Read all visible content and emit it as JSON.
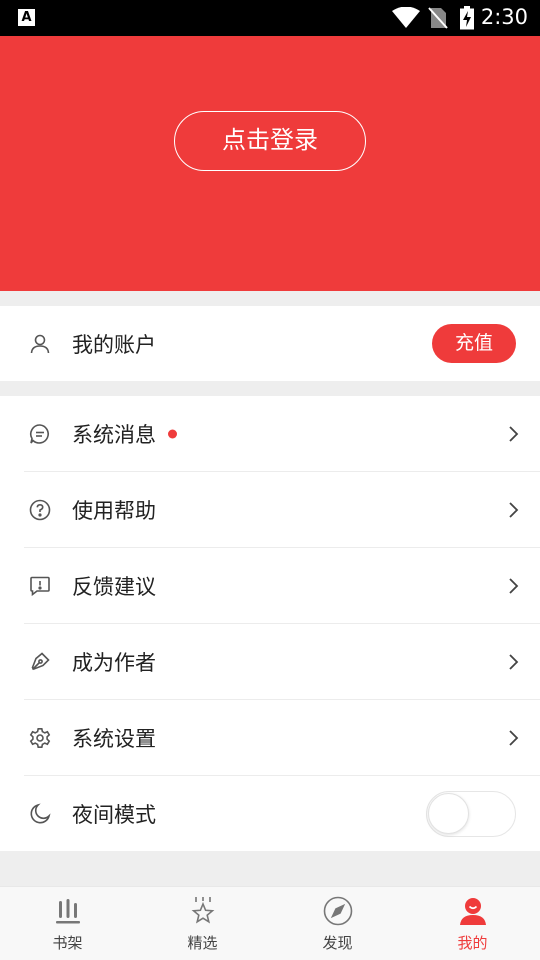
{
  "status_bar": {
    "app_icon": "A",
    "time": "2:30",
    "icons": [
      "wifi-icon",
      "no-sim-icon",
      "battery-charging-icon"
    ]
  },
  "header": {
    "login_label": "点击登录",
    "background_color": "#ef3b3b"
  },
  "account": {
    "icon": "user-icon",
    "label": "我的账户",
    "recharge_label": "充值"
  },
  "menu": {
    "items": [
      {
        "icon": "message-icon",
        "label": "系统消息",
        "has_badge": true
      },
      {
        "icon": "help-icon",
        "label": "使用帮助"
      },
      {
        "icon": "feedback-icon",
        "label": "反馈建议"
      },
      {
        "icon": "pen-icon",
        "label": "成为作者"
      },
      {
        "icon": "settings-icon",
        "label": "系统设置"
      }
    ],
    "night_mode": {
      "icon": "moon-icon",
      "label": "夜间模式",
      "enabled": false
    }
  },
  "tabbar": {
    "tabs": [
      {
        "icon": "bookshelf-icon",
        "label": "书架",
        "active": false
      },
      {
        "icon": "star-icon",
        "label": "精选",
        "active": false
      },
      {
        "icon": "compass-icon",
        "label": "发现",
        "active": false
      },
      {
        "icon": "profile-icon",
        "label": "我的",
        "active": true
      }
    ],
    "accent_color": "#ef3b3b"
  }
}
